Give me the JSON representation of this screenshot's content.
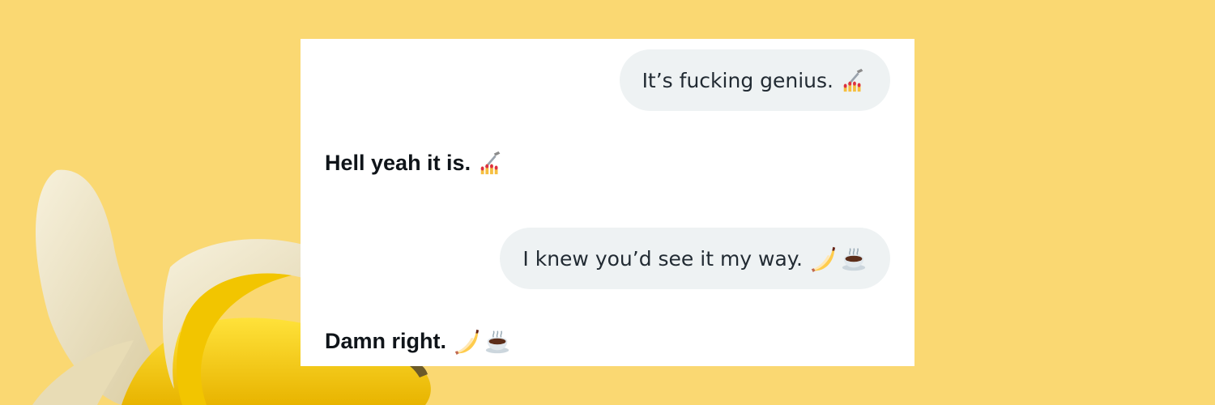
{
  "background_color": "#fad872",
  "card_color": "#ffffff",
  "bubble_color": "#eef2f3",
  "messages": [
    {
      "id": "m1",
      "from": "other",
      "text": "It’s fucking genius.",
      "emojis": [
        "nail-polish-icon"
      ]
    },
    {
      "id": "m2",
      "from": "me",
      "text": "Hell yeah it is.",
      "emojis": [
        "nail-polish-icon"
      ]
    },
    {
      "id": "m3",
      "from": "other",
      "text": "I knew you’d see it my way.",
      "emojis": [
        "banana-icon",
        "hot-beverage-icon"
      ]
    },
    {
      "id": "m4",
      "from": "me",
      "text": "Damn right.",
      "emojis": [
        "banana-icon",
        "hot-beverage-icon"
      ]
    }
  ]
}
